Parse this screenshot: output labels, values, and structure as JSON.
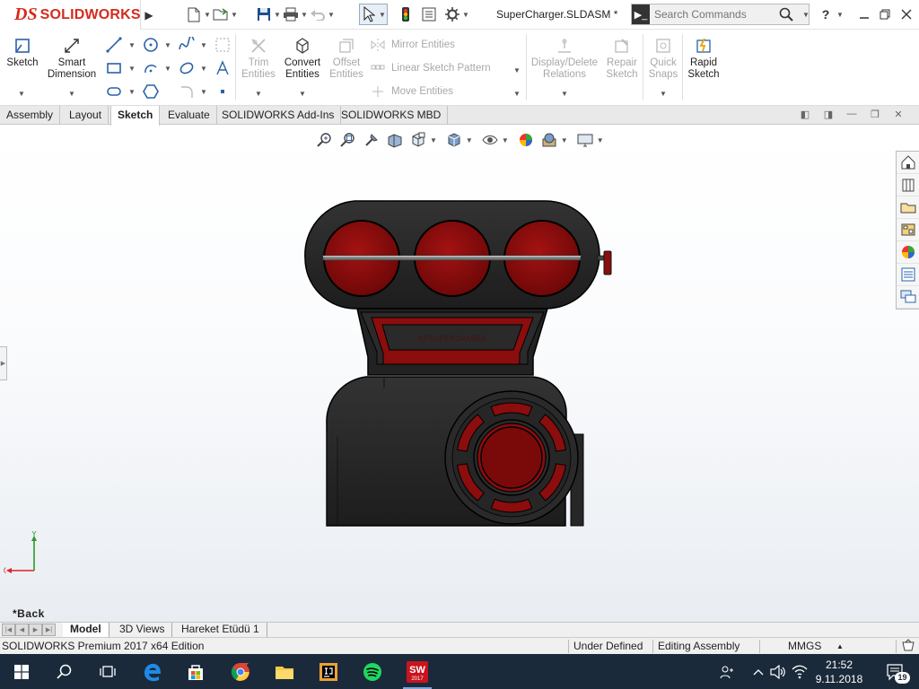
{
  "app": {
    "brand_prefix": "DS",
    "brand_name": "SOLIDWORKS",
    "document_title": "SuperCharger.SLDASM *"
  },
  "quick_access": {
    "icons": [
      "new-document-icon",
      "open-icon",
      "save-icon",
      "print-icon",
      "undo-icon",
      "select-icon",
      "rebuild-icon",
      "file-properties-icon",
      "options-icon"
    ]
  },
  "search": {
    "placeholder": "Search Commands",
    "help_label": "?"
  },
  "ribbon": {
    "sketch": "Sketch",
    "smart_dimension_1": "Smart",
    "smart_dimension_2": "Dimension",
    "trim_1": "Trim",
    "trim_2": "Entities",
    "convert_1": "Convert",
    "convert_2": "Entities",
    "offset_1": "Offset",
    "offset_2": "Entities",
    "mirror": "Mirror Entities",
    "linear_pattern": "Linear Sketch Pattern",
    "move": "Move Entities",
    "display_delete_1": "Display/Delete",
    "display_delete_2": "Relations",
    "repair_1": "Repair",
    "repair_2": "Sketch",
    "quick_snaps_1": "Quick",
    "quick_snaps_2": "Snaps",
    "rapid_1": "Rapid",
    "rapid_2": "Sketch"
  },
  "tabs": [
    {
      "label": "Assembly"
    },
    {
      "label": "Layout"
    },
    {
      "label": "Sketch"
    },
    {
      "label": "Evaluate"
    },
    {
      "label": "SOLIDWORKS Add-Ins"
    },
    {
      "label": "SOLIDWORKS MBD"
    }
  ],
  "active_tab": "Sketch",
  "viewport": {
    "back_label": "*Back",
    "triad_y": "Y",
    "triad_x": "X",
    "model_plate_text": "HPSUPERCHARGE",
    "colors": {
      "body": "#2b2b2b",
      "accent_red": "#8b0d0d",
      "outline": "#000000"
    }
  },
  "model_tabs": [
    {
      "label": "Model"
    },
    {
      "label": "3D Views"
    },
    {
      "label": "Hareket Etüdü 1"
    }
  ],
  "status": {
    "edition": "SOLIDWORKS Premium 2017 x64 Edition",
    "state": "Under Defined",
    "mode": "Editing Assembly",
    "units": "MMGS",
    "units_arrow": "▲"
  },
  "taskbar": {
    "apps": [
      "windows-start-icon",
      "search-icon",
      "task-view-icon",
      "edge-icon",
      "store-icon",
      "chrome-icon",
      "file-explorer-icon",
      "intellij-icon",
      "spotify-icon",
      "solidworks-icon"
    ],
    "solidworks_badge": "SW",
    "solidworks_year": "2017",
    "time": "21:52",
    "date": "9.11.2018",
    "notification_count": "19"
  }
}
